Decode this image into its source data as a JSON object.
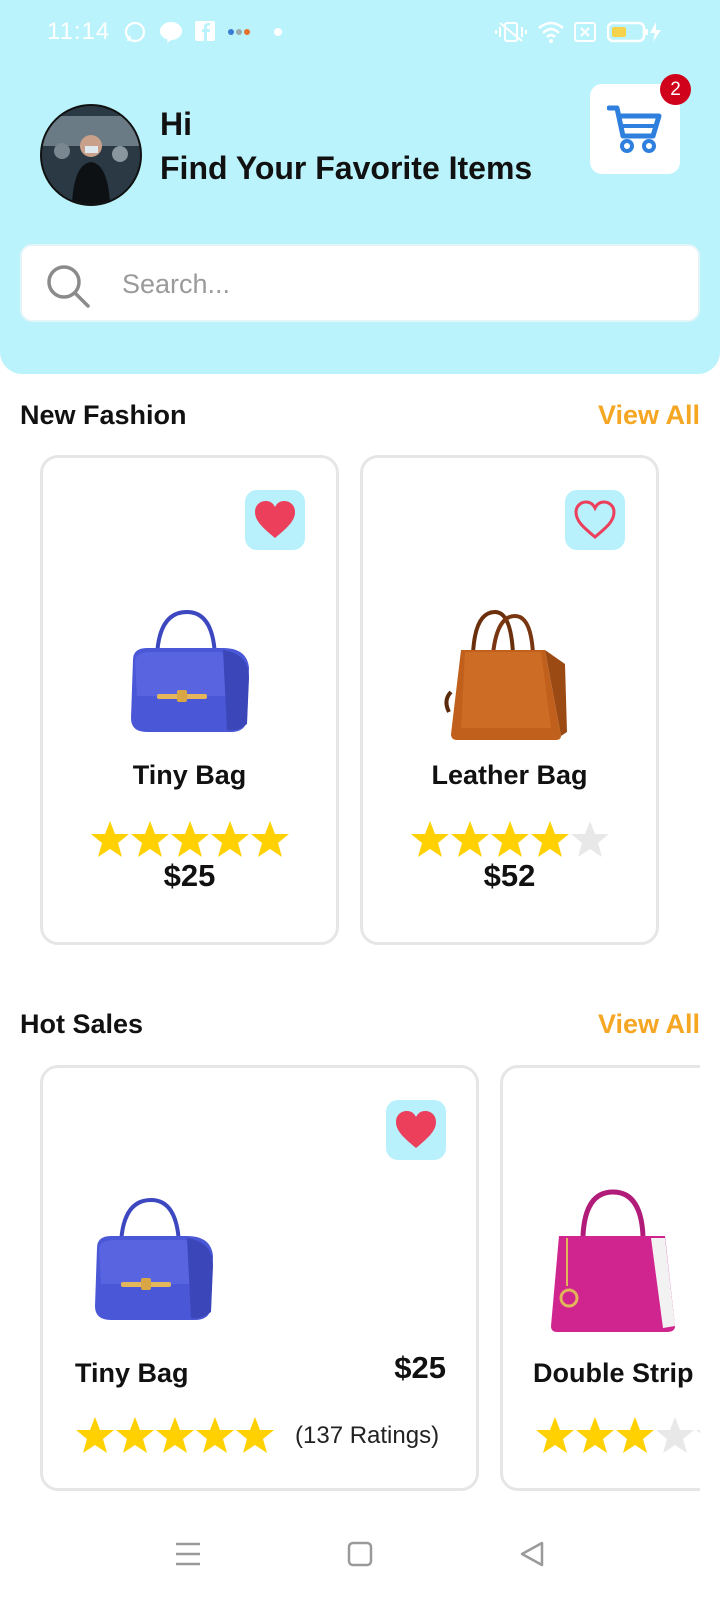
{
  "status_bar": {
    "time": "11:14"
  },
  "header": {
    "greeting": "Hi",
    "subtitle": "Find Your Favorite Items",
    "cart_count": "2"
  },
  "search": {
    "placeholder": "Search..."
  },
  "new_fashion": {
    "title": "New Fashion",
    "view_all": "View All",
    "products": [
      {
        "name": "Tiny Bag",
        "price": "$25",
        "rating": 5,
        "favorite": true,
        "color": "#4a57d6"
      },
      {
        "name": "Leather Bag",
        "price": "$52",
        "rating": 4,
        "favorite": false,
        "color": "#c0601c"
      }
    ]
  },
  "hot_sales": {
    "title": "Hot Sales",
    "view_all": "View All",
    "products": [
      {
        "name": "Tiny Bag",
        "price": "$25",
        "rating": 5,
        "ratings_text": "(137 Ratings)",
        "favorite": true,
        "color": "#4a57d6"
      },
      {
        "name": "Double Strip Bag",
        "rating": 3,
        "color": "#d0248f"
      }
    ]
  },
  "colors": {
    "header_bg": "#baf3fb",
    "accent": "#f5a623",
    "star": "#ffd100",
    "heart": "#ec3f5c",
    "cart": "#2f7fde"
  }
}
